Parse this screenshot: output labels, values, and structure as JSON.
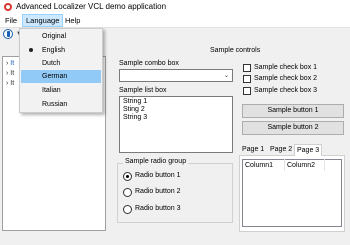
{
  "window": {
    "title": "Advanced Localizer VCL demo application"
  },
  "menu": {
    "items": [
      "File",
      "Language",
      "Help"
    ]
  },
  "language_menu": {
    "items": [
      "Original",
      "English",
      "Dutch",
      "German",
      "Italian",
      "Russian"
    ],
    "selected": "English",
    "highlighted": "German"
  },
  "tree": {
    "rows": [
      "It",
      "It",
      "It"
    ]
  },
  "controls": {
    "group_title": "Sample controls",
    "combo_label": "Sample combo box",
    "combo_value": "",
    "list_label": "Sample list box",
    "list_items": [
      "String 1",
      "Sting 2",
      "String 3"
    ],
    "radio_group_title": "Sample radio group",
    "radio_buttons": [
      "Radio button 1",
      "Radio button 2",
      "Radio button 3"
    ],
    "radio_selected": "Radio button 1",
    "checkboxes": [
      "Sample check box 1",
      "Sample check box 2",
      "Sample check box 3"
    ],
    "buttons": [
      "Sample button 1",
      "Sample button 2"
    ]
  },
  "pages": {
    "tabs": [
      "Page 1",
      "Page 2",
      "Page 3"
    ],
    "active": "Page 3",
    "columns": [
      "Column1",
      "Column2"
    ]
  }
}
